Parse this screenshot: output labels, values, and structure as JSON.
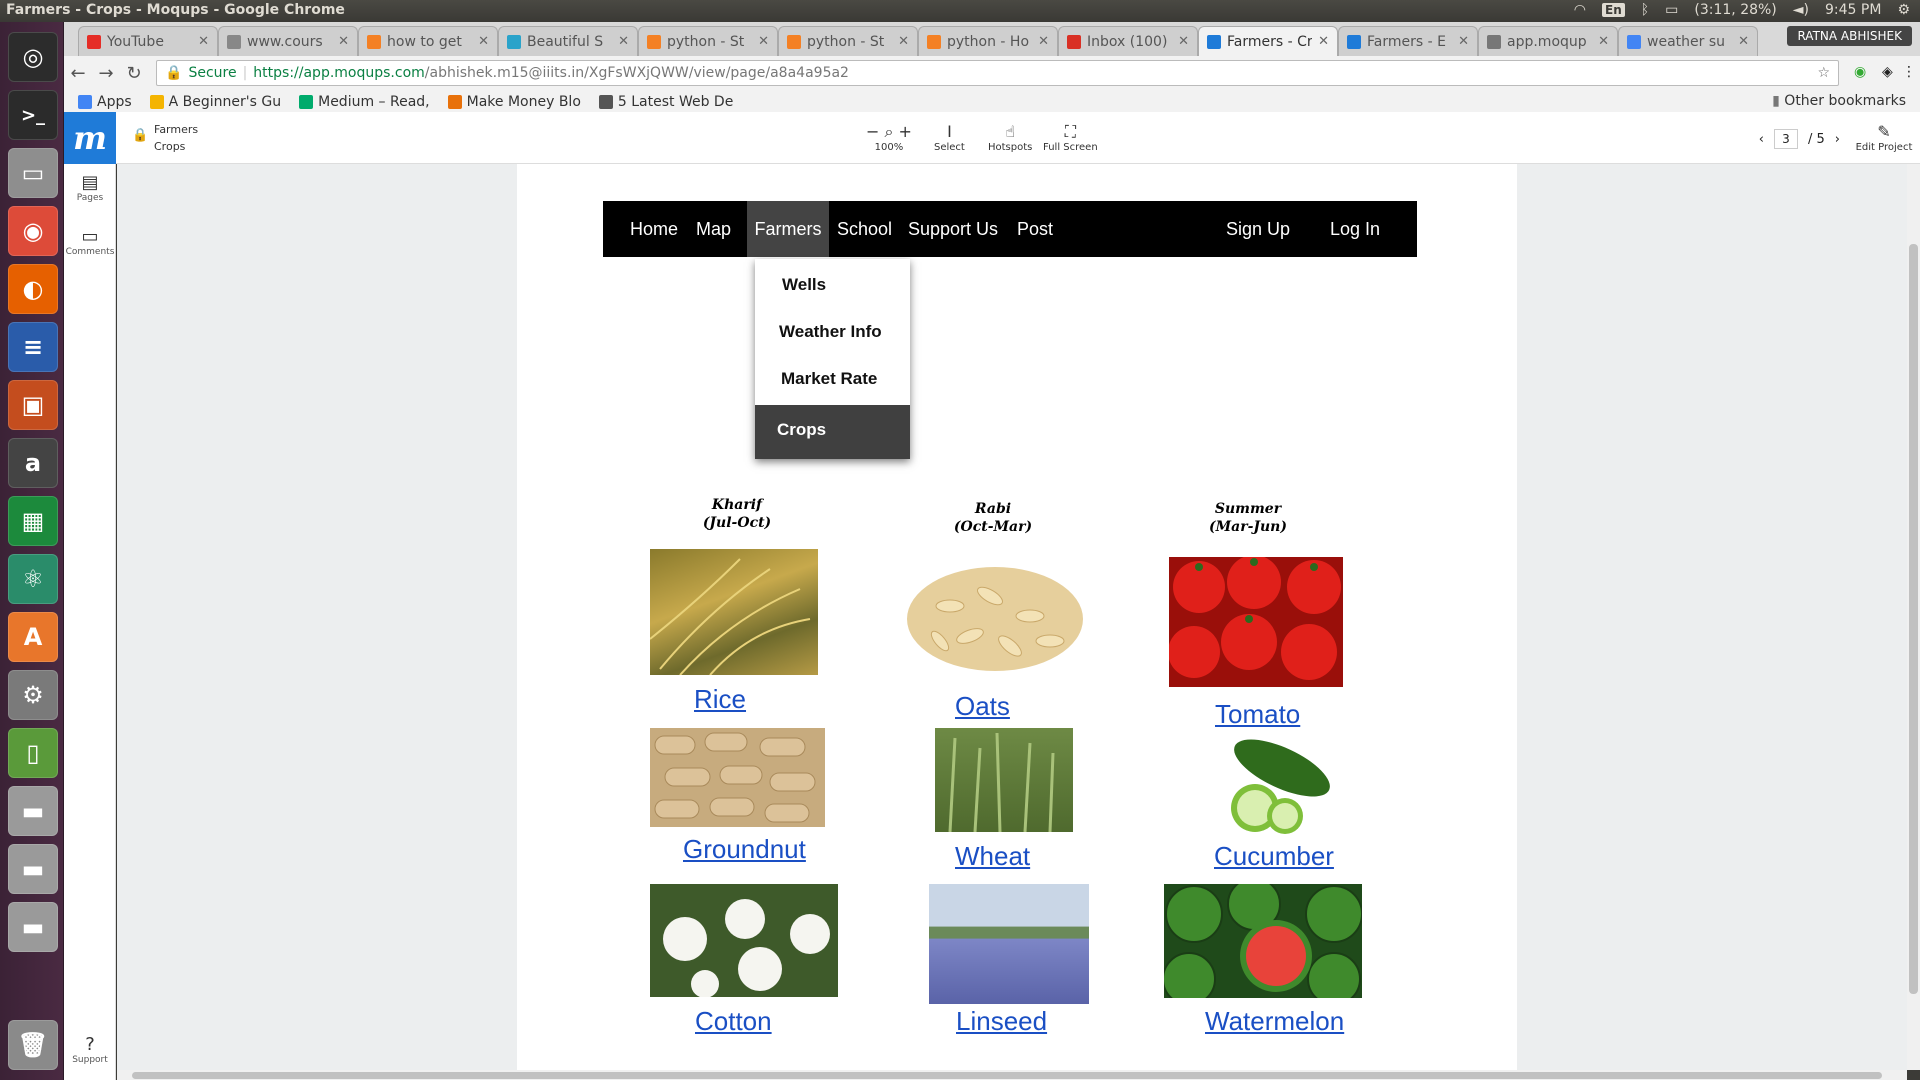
{
  "os": {
    "window_title": "Farmers - Crops - Moqups - Google Chrome",
    "keyboard": "En",
    "battery": "(3:11, 28%)",
    "clock": "9:45 PM",
    "user": "RATNA ABHISHEK"
  },
  "tabs": [
    {
      "title": "YouTube",
      "color": "#e52d27"
    },
    {
      "title": "www.cours",
      "color": "#888888"
    },
    {
      "title": "how to get",
      "color": "#f48024"
    },
    {
      "title": "Beautiful S",
      "color": "#2aa3ca"
    },
    {
      "title": "python - St",
      "color": "#f48024"
    },
    {
      "title": "python - St",
      "color": "#f48024"
    },
    {
      "title": "python - Ho",
      "color": "#f48024"
    },
    {
      "title": "Inbox (100)",
      "color": "#d93025"
    },
    {
      "title": "Farmers - Cr",
      "color": "#1f7bd8"
    },
    {
      "title": "Farmers - E",
      "color": "#1f7bd8"
    },
    {
      "title": "app.moqup",
      "color": "#777777"
    },
    {
      "title": "weather su",
      "color": "#4285f4"
    }
  ],
  "omnibox": {
    "secure_label": "Secure",
    "url_host": "https://app.moqups.com",
    "url_path": "/abhishek.m15@iiits.in/XgFsWXjQWW/view/page/a8a4a95a2"
  },
  "bookmarks": [
    {
      "label": "Apps",
      "color": "#4285f4"
    },
    {
      "label": "A Beginner's Gu",
      "color": "#f4b400"
    },
    {
      "label": "Medium – Read,",
      "color": "#00ab6c"
    },
    {
      "label": "Make Money Blo",
      "color": "#e8710a"
    },
    {
      "label": "5 Latest Web De",
      "color": "#555555"
    }
  ],
  "other_bookmarks": "Other bookmarks",
  "moqups": {
    "logo": "m",
    "breadcrumb_project": "Farmers",
    "breadcrumb_page": "Crops",
    "zoom": "100%",
    "tools": [
      "Select",
      "Hotspots",
      "Full Screen"
    ],
    "page_current": "3",
    "page_total": "/ 5",
    "edit": "Edit Project",
    "side": [
      "Pages",
      "Comments",
      "Support"
    ]
  },
  "site": {
    "nav": [
      "Home",
      "Map",
      "Farmers",
      "School",
      "Support Us",
      "Post",
      "Sign Up",
      "Log In"
    ],
    "dropdown": [
      "Wells",
      "Weather Info",
      "Market Rate",
      "Crops"
    ],
    "seasons": [
      {
        "name": "Kharif",
        "range": "(Jul-Oct)"
      },
      {
        "name": "Rabi",
        "range": "(Oct-Mar)"
      },
      {
        "name": "Summer",
        "range": "(Mar-Jun)"
      }
    ],
    "crops": [
      "Rice",
      "Oats",
      "Tomato",
      "Groundnut",
      "Wheat",
      "Cucumber",
      "Cotton",
      "Linseed",
      "Watermelon"
    ]
  }
}
